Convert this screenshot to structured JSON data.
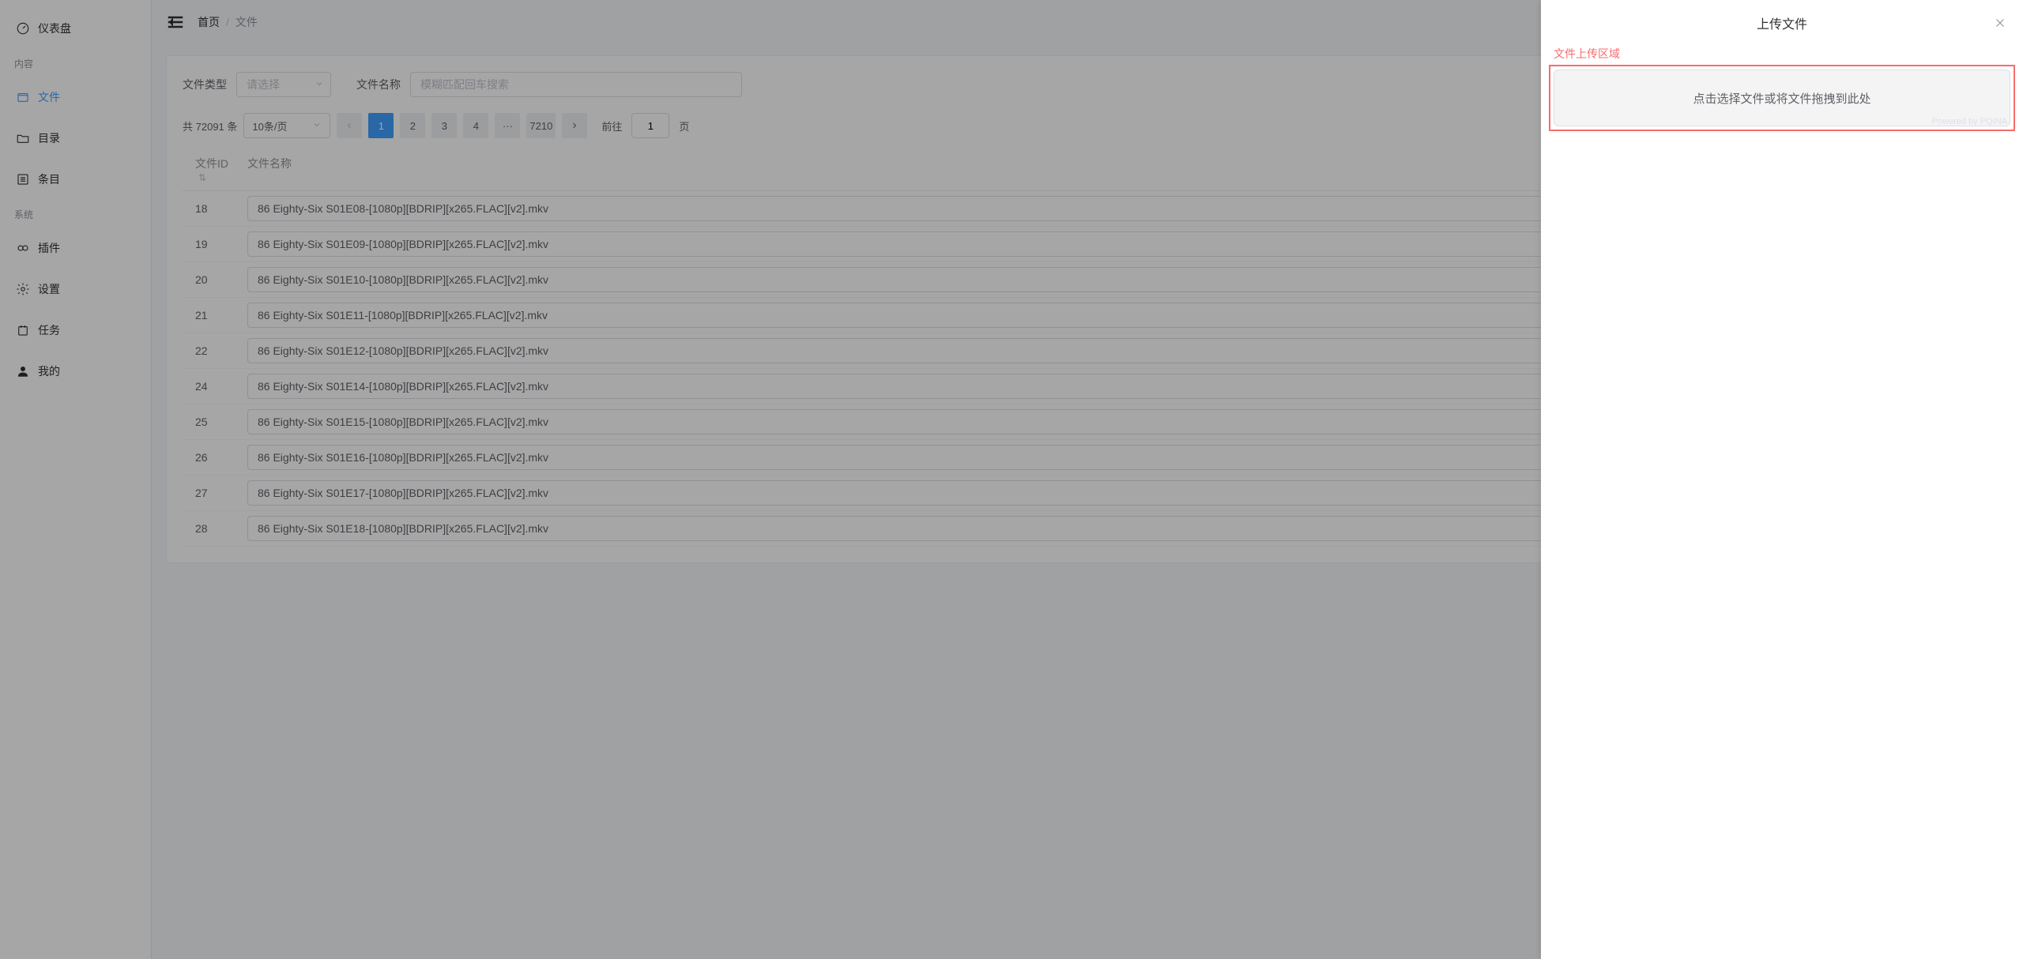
{
  "sidebar": {
    "dashboard": "仪表盘",
    "section_content": "内容",
    "files": "文件",
    "directory": "目录",
    "items": "条目",
    "section_system": "系统",
    "plugins": "插件",
    "settings": "设置",
    "tasks": "任务",
    "mine": "我的"
  },
  "breadcrumb": {
    "home": "首页",
    "sep": "/",
    "current": "文件"
  },
  "filters": {
    "file_type_label": "文件类型",
    "file_type_placeholder": "请选择",
    "file_name_label": "文件名称",
    "file_name_placeholder": "模糊匹配回车搜索"
  },
  "pagination": {
    "total_prefix": "共 ",
    "total_count": "72091",
    "total_suffix": " 条",
    "page_size": "10条/页",
    "pages": [
      "1",
      "2",
      "3",
      "4"
    ],
    "ellipsis": "···",
    "last": "7210",
    "goto_prefix": "前往",
    "current_page": "1",
    "goto_suffix": "页"
  },
  "table": {
    "col_id": "文件ID",
    "col_name": "文件名称",
    "sort_caret": "⇅",
    "rows": [
      {
        "id": "18",
        "name": "86 Eighty-Six S01E08-[1080p][BDRIP][x265.FLAC][v2].mkv"
      },
      {
        "id": "19",
        "name": "86 Eighty-Six S01E09-[1080p][BDRIP][x265.FLAC][v2].mkv"
      },
      {
        "id": "20",
        "name": "86 Eighty-Six S01E10-[1080p][BDRIP][x265.FLAC][v2].mkv"
      },
      {
        "id": "21",
        "name": "86 Eighty-Six S01E11-[1080p][BDRIP][x265.FLAC][v2].mkv"
      },
      {
        "id": "22",
        "name": "86 Eighty-Six S01E12-[1080p][BDRIP][x265.FLAC][v2].mkv"
      },
      {
        "id": "24",
        "name": "86 Eighty-Six S01E14-[1080p][BDRIP][x265.FLAC][v2].mkv"
      },
      {
        "id": "25",
        "name": "86 Eighty-Six S01E15-[1080p][BDRIP][x265.FLAC][v2].mkv"
      },
      {
        "id": "26",
        "name": "86 Eighty-Six S01E16-[1080p][BDRIP][x265.FLAC][v2].mkv"
      },
      {
        "id": "27",
        "name": "86 Eighty-Six S01E17-[1080p][BDRIP][x265.FLAC][v2].mkv"
      },
      {
        "id": "28",
        "name": "86 Eighty-Six S01E18-[1080p][BDRIP][x265.FLAC][v2].mkv"
      }
    ]
  },
  "drawer": {
    "title": "上传文件",
    "upload_label": "文件上传区域",
    "upload_text": "点击选择文件或将文件拖拽到此处",
    "powered": "Powered by PQINA"
  }
}
